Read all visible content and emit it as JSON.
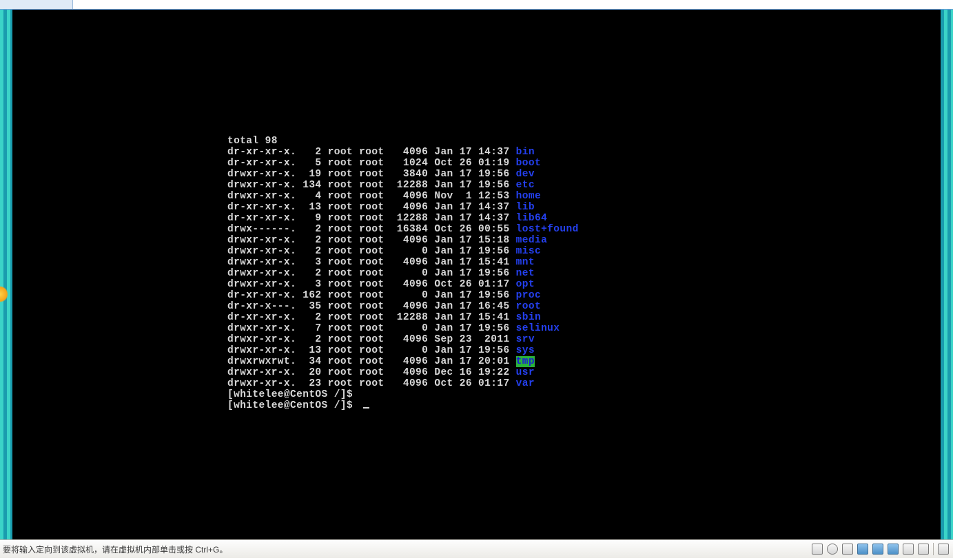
{
  "terminal": {
    "total_line": "total 98",
    "entries": [
      {
        "perm": "dr-xr-xr-x.",
        "links": "  2",
        "own": "root",
        "grp": "root",
        "size": "  4096",
        "date": "Jan 17 14:37",
        "name": "bin",
        "cls": "c-blue"
      },
      {
        "perm": "dr-xr-xr-x.",
        "links": "  5",
        "own": "root",
        "grp": "root",
        "size": "  1024",
        "date": "Oct 26 01:19",
        "name": "boot",
        "cls": "c-blue"
      },
      {
        "perm": "drwxr-xr-x.",
        "links": " 19",
        "own": "root",
        "grp": "root",
        "size": "  3840",
        "date": "Jan 17 19:56",
        "name": "dev",
        "cls": "c-blue"
      },
      {
        "perm": "drwxr-xr-x.",
        "links": "134",
        "own": "root",
        "grp": "root",
        "size": " 12288",
        "date": "Jan 17 19:56",
        "name": "etc",
        "cls": "c-blue"
      },
      {
        "perm": "drwxr-xr-x.",
        "links": "  4",
        "own": "root",
        "grp": "root",
        "size": "  4096",
        "date": "Nov  1 12:53",
        "name": "home",
        "cls": "c-blue"
      },
      {
        "perm": "dr-xr-xr-x.",
        "links": " 13",
        "own": "root",
        "grp": "root",
        "size": "  4096",
        "date": "Jan 17 14:37",
        "name": "lib",
        "cls": "c-blue"
      },
      {
        "perm": "dr-xr-xr-x.",
        "links": "  9",
        "own": "root",
        "grp": "root",
        "size": " 12288",
        "date": "Jan 17 14:37",
        "name": "lib64",
        "cls": "c-blue"
      },
      {
        "perm": "drwx------.",
        "links": "  2",
        "own": "root",
        "grp": "root",
        "size": " 16384",
        "date": "Oct 26 00:55",
        "name": "lost+found",
        "cls": "c-blue"
      },
      {
        "perm": "drwxr-xr-x.",
        "links": "  2",
        "own": "root",
        "grp": "root",
        "size": "  4096",
        "date": "Jan 17 15:18",
        "name": "media",
        "cls": "c-blue"
      },
      {
        "perm": "drwxr-xr-x.",
        "links": "  2",
        "own": "root",
        "grp": "root",
        "size": "     0",
        "date": "Jan 17 19:56",
        "name": "misc",
        "cls": "c-blue"
      },
      {
        "perm": "drwxr-xr-x.",
        "links": "  3",
        "own": "root",
        "grp": "root",
        "size": "  4096",
        "date": "Jan 17 15:41",
        "name": "mnt",
        "cls": "c-blue"
      },
      {
        "perm": "drwxr-xr-x.",
        "links": "  2",
        "own": "root",
        "grp": "root",
        "size": "     0",
        "date": "Jan 17 19:56",
        "name": "net",
        "cls": "c-blue"
      },
      {
        "perm": "drwxr-xr-x.",
        "links": "  3",
        "own": "root",
        "grp": "root",
        "size": "  4096",
        "date": "Oct 26 01:17",
        "name": "opt",
        "cls": "c-blue"
      },
      {
        "perm": "dr-xr-xr-x.",
        "links": "162",
        "own": "root",
        "grp": "root",
        "size": "     0",
        "date": "Jan 17 19:56",
        "name": "proc",
        "cls": "c-blue"
      },
      {
        "perm": "dr-xr-x---.",
        "links": " 35",
        "own": "root",
        "grp": "root",
        "size": "  4096",
        "date": "Jan 17 16:45",
        "name": "root",
        "cls": "c-blue"
      },
      {
        "perm": "dr-xr-xr-x.",
        "links": "  2",
        "own": "root",
        "grp": "root",
        "size": " 12288",
        "date": "Jan 17 15:41",
        "name": "sbin",
        "cls": "c-blue"
      },
      {
        "perm": "drwxr-xr-x.",
        "links": "  7",
        "own": "root",
        "grp": "root",
        "size": "     0",
        "date": "Jan 17 19:56",
        "name": "selinux",
        "cls": "c-blue"
      },
      {
        "perm": "drwxr-xr-x.",
        "links": "  2",
        "own": "root",
        "grp": "root",
        "size": "  4096",
        "date": "Sep 23  2011",
        "name": "srv",
        "cls": "c-blue"
      },
      {
        "perm": "drwxr-xr-x.",
        "links": " 13",
        "own": "root",
        "grp": "root",
        "size": "     0",
        "date": "Jan 17 19:56",
        "name": "sys",
        "cls": "c-blue"
      },
      {
        "perm": "drwxrwxrwt.",
        "links": " 34",
        "own": "root",
        "grp": "root",
        "size": "  4096",
        "date": "Jan 17 20:01",
        "name": "tmp",
        "cls": "bg-green"
      },
      {
        "perm": "drwxr-xr-x.",
        "links": " 20",
        "own": "root",
        "grp": "root",
        "size": "  4096",
        "date": "Dec 16 19:22",
        "name": "usr",
        "cls": "c-blue"
      },
      {
        "perm": "drwxr-xr-x.",
        "links": " 23",
        "own": "root",
        "grp": "root",
        "size": "  4096",
        "date": "Oct 26 01:17",
        "name": "var",
        "cls": "c-blue"
      }
    ],
    "prompt1": "[whitelee@CentOS /]$",
    "prompt2": "[whitelee@CentOS /]$ "
  },
  "statusbar": {
    "hint": "要将输入定向到该虚拟机，请在虚拟机内部单击或按 Ctrl+G。"
  },
  "tray_icons": [
    "device-hdd-icon",
    "device-cd-icon",
    "device-floppy-icon",
    "device-net-icon",
    "device-screen-icon",
    "device-usb-icon",
    "device-sound-icon",
    "device-printer-icon",
    "vm-message-icon"
  ]
}
